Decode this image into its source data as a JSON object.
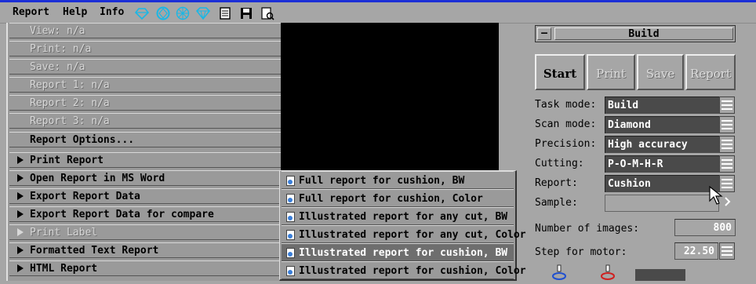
{
  "menubar": {
    "items": [
      "Report",
      "Help",
      "Info"
    ],
    "toolbar_icons": [
      "diamond-outline-icon",
      "round-gem-icon",
      "gem-facets-icon",
      "heart-gem-icon",
      "notepad-icon",
      "floppy-disk-icon",
      "report-document-icon"
    ]
  },
  "report_menu": {
    "items": [
      {
        "label": "View: n/a",
        "enabled": false,
        "submenu": false
      },
      {
        "label": "Print: n/a",
        "enabled": false,
        "submenu": false
      },
      {
        "label": "Save: n/a",
        "enabled": false,
        "submenu": false
      },
      {
        "label": "Report 1: n/a",
        "enabled": false,
        "submenu": false
      },
      {
        "label": "Report 2: n/a",
        "enabled": false,
        "submenu": false
      },
      {
        "label": "Report 3: n/a",
        "enabled": false,
        "submenu": false
      },
      {
        "label": "Report Options...",
        "enabled": true,
        "submenu": false
      },
      {
        "label": "Print Report",
        "enabled": true,
        "submenu": true
      },
      {
        "label": "Open Report in MS Word",
        "enabled": true,
        "submenu": true
      },
      {
        "label": "Export Report Data",
        "enabled": true,
        "submenu": true
      },
      {
        "label": "Export Report Data for compare",
        "enabled": true,
        "submenu": true
      },
      {
        "label": "Print Label",
        "enabled": false,
        "submenu": true
      },
      {
        "label": "Formatted Text Report",
        "enabled": true,
        "submenu": true
      },
      {
        "label": "HTML Report",
        "enabled": true,
        "submenu": true
      }
    ]
  },
  "submenu": {
    "items": [
      {
        "label": "Full report for cushion, BW",
        "highlighted": false
      },
      {
        "label": "Full report for cushion, Color",
        "highlighted": false
      },
      {
        "label": "Illustrated report for any cut, BW",
        "highlighted": false
      },
      {
        "label": "Illustrated report for any cut, Color",
        "highlighted": false
      },
      {
        "label": "Illustrated report for cushion, BW",
        "highlighted": true
      },
      {
        "label": "Illustrated report for cushion, Color",
        "highlighted": false
      }
    ]
  },
  "panel": {
    "minimize_label": "–",
    "title": "Build",
    "buttons": [
      {
        "label": "Start",
        "enabled": true
      },
      {
        "label": "Print",
        "enabled": false
      },
      {
        "label": "Save",
        "enabled": false
      },
      {
        "label": "Report",
        "enabled": false
      }
    ],
    "fields": [
      {
        "label": "Task mode:",
        "value": "Build"
      },
      {
        "label": "Scan mode:",
        "value": "Diamond"
      },
      {
        "label": "Precision:",
        "value": "High accuracy"
      },
      {
        "label": "Cutting:",
        "value": "P-O-M-H-R"
      },
      {
        "label": "Report:",
        "value": "Cushion"
      },
      {
        "label": "Sample:",
        "value": ""
      }
    ],
    "num_images_label": "Number of images:",
    "num_images_value": "800",
    "step_motor_label": "Step for motor:",
    "step_motor_value": "22.50"
  },
  "colors": {
    "background": "#a6a6a6",
    "title_line": "#1c2fd6",
    "dark_field": "#4a4a4a"
  }
}
